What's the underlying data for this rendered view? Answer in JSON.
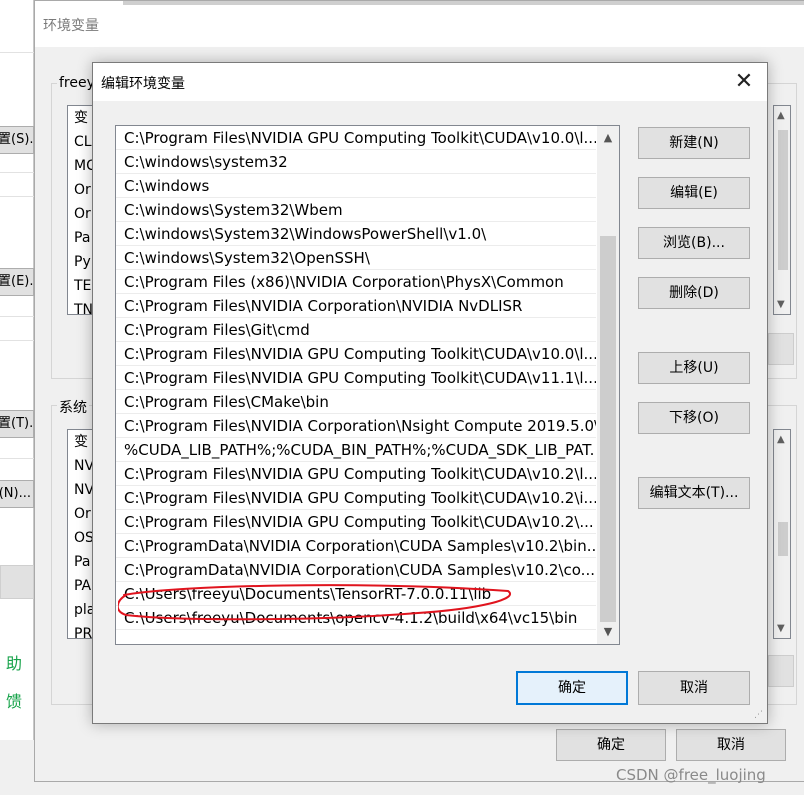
{
  "background_window": {
    "button_labels": [
      "置(S)...",
      "置(E)...",
      "置(T)...",
      "(N)..."
    ],
    "green_texts": [
      "助",
      "馈"
    ]
  },
  "outer_window": {
    "title": "环境变量",
    "user_group_label": "freey",
    "user_vars_list": [
      "变",
      "CL",
      "MC",
      "Or",
      "Or",
      "Pa",
      "Py",
      "TE",
      "TN"
    ],
    "system_group_label": "系统",
    "system_vars_list": [
      "变",
      "NV",
      "NV",
      "Or",
      "OS",
      "Pa",
      "PA",
      "pla",
      "PR"
    ],
    "ok_label": "确定",
    "cancel_label": "取消"
  },
  "dialog": {
    "title": "编辑环境变量",
    "close_glyph": "✕",
    "paths": [
      "C:\\Program Files\\NVIDIA GPU Computing Toolkit\\CUDA\\v10.0\\l...",
      "C:\\windows\\system32",
      "C:\\windows",
      "C:\\windows\\System32\\Wbem",
      "C:\\windows\\System32\\WindowsPowerShell\\v1.0\\",
      "C:\\windows\\System32\\OpenSSH\\",
      "C:\\Program Files (x86)\\NVIDIA Corporation\\PhysX\\Common",
      "C:\\Program Files\\NVIDIA Corporation\\NVIDIA NvDLISR",
      "C:\\Program Files\\Git\\cmd",
      "C:\\Program Files\\NVIDIA GPU Computing Toolkit\\CUDA\\v10.0\\l...",
      "C:\\Program Files\\NVIDIA GPU Computing Toolkit\\CUDA\\v11.1\\l...",
      "C:\\Program Files\\CMake\\bin",
      "C:\\Program Files\\NVIDIA Corporation\\Nsight Compute 2019.5.0\\",
      "%CUDA_LIB_PATH%;%CUDA_BIN_PATH%;%CUDA_SDK_LIB_PAT...",
      "C:\\Program Files\\NVIDIA GPU Computing Toolkit\\CUDA\\v10.2\\l...",
      "C:\\Program Files\\NVIDIA GPU Computing Toolkit\\CUDA\\v10.2\\i...",
      "C:\\Program Files\\NVIDIA GPU Computing Toolkit\\CUDA\\v10.2\\...",
      "C:\\ProgramData\\NVIDIA Corporation\\CUDA Samples\\v10.2\\bin...",
      "C:\\ProgramData\\NVIDIA Corporation\\CUDA Samples\\v10.2\\co...",
      "C:\\Users\\freeyu\\Documents\\TensorRT-7.0.0.11\\lib",
      "C:\\Users\\freeyu\\Documents\\opencv-4.1.2\\build\\x64\\vc15\\bin"
    ],
    "side_buttons": {
      "new": "新建(N)",
      "edit": "编辑(E)",
      "browse": "浏览(B)...",
      "delete": "删除(D)",
      "move_up": "上移(U)",
      "move_down": "下移(O)",
      "edit_text": "编辑文本(T)..."
    },
    "ok_label": "确定",
    "cancel_label": "取消",
    "annotation_color": "#e0141e",
    "accent_color": "#0078d7"
  },
  "watermark": "CSDN @free_luojing"
}
